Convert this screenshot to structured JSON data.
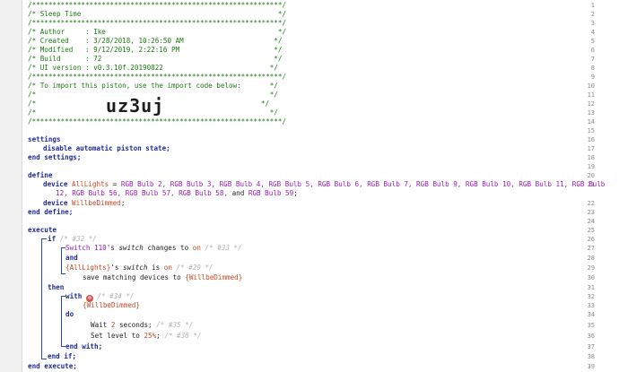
{
  "header": {
    "border": "/*************************************************************/",
    "title": "/* Sleep Time                                                */",
    "author": "/* Author     : Ike                                          */",
    "created": "/* Created    : 3/28/2018, 10:26:50 AM                      */",
    "modified": "/* Modified   : 9/12/2019, 2:22:16 PM                       */",
    "build": "/* Build      : 72                                          */",
    "ui_version": "/* UI version : v0.3.10f.20190822                          */",
    "import_hint": "/* To import this piston, use the import code below:       */",
    "blank": "/*                                                         */",
    "import_prefix": "/*",
    "import_suffix": "*/",
    "import_code": "uz3uj"
  },
  "line_numbers": [
    "1",
    "2",
    "3",
    "4",
    "5",
    "6",
    "7",
    "8",
    "9",
    "10",
    "11",
    "12",
    "13",
    "14",
    "15",
    "16",
    "17",
    "18",
    "19",
    "20",
    "21",
    "22",
    "23",
    "24",
    "25",
    "26",
    "27",
    "28",
    "29",
    "30",
    "31",
    "32",
    "33",
    "34",
    "35",
    "36",
    "37",
    "38",
    "39"
  ],
  "code": {
    "settings": "settings",
    "disable_state": "disable automatic piston state;",
    "end_settings": "end settings;",
    "define": "define",
    "device_kw": "device",
    "all_lights_var": "AllLights",
    "eq": " = ",
    "all_lights_value_1": "RGB Bulb 2, RGB Bulb 3, RGB Bulb 4, RGB Bulb 5, RGB Bulb 6, RGB Bulb 7, RGB Bulb 9, RGB Bulb 10, RGB Bulb 11, RGB Bulb",
    "all_lights_value_2a": "12, RGB Bulb 56, RGB Bulb 57, RGB Bulb 58,",
    "and_kw": " and ",
    "all_lights_value_2b": "RGB Bulb 59",
    "semi": ";",
    "willbedimmed_var": "WillbeDimmed",
    "end_define": "end define;",
    "execute": "execute",
    "if_kw": "if",
    "if_comment": "/* #32 */",
    "cond1_device": "Switch 110",
    "cond1_mid1": "'s ",
    "cond1_attr": "switch",
    "cond1_mid2": " changes to ",
    "cond1_value": "on",
    "cond1_comment": "/* #33 */",
    "and": "and",
    "cond2_var": "{AllLights}",
    "cond2_mid1": "'s ",
    "cond2_attr": "switch",
    "cond2_mid2": " is ",
    "cond2_value": "on",
    "cond2_comment": "/* #29 */",
    "save_matching": "save matching devices to ",
    "save_var": "{WillbeDimmed}",
    "then": "then",
    "with_kw": "with",
    "with_comment": "/* #34 */",
    "with_var": "{WillbeDimmed}",
    "do": "do",
    "wait_text": "Wait ",
    "wait_value": "2",
    "wait_unit": " seconds;",
    "wait_comment": "/* #35 */",
    "level_text": "Set level to ",
    "level_value": "25%",
    "level_semi": ";",
    "level_comment": "/* #36 */",
    "end_with": "end with;",
    "end_if": "end if;",
    "end_execute": "end execute;"
  },
  "colors": {
    "comment": "#1d7a12",
    "keyword": "#1e2a9c",
    "device": "#9a1fb5",
    "variable": "#c14a2a",
    "gutter": "#f1f1f1"
  },
  "icons": {
    "with_badge": "gear-icon"
  }
}
